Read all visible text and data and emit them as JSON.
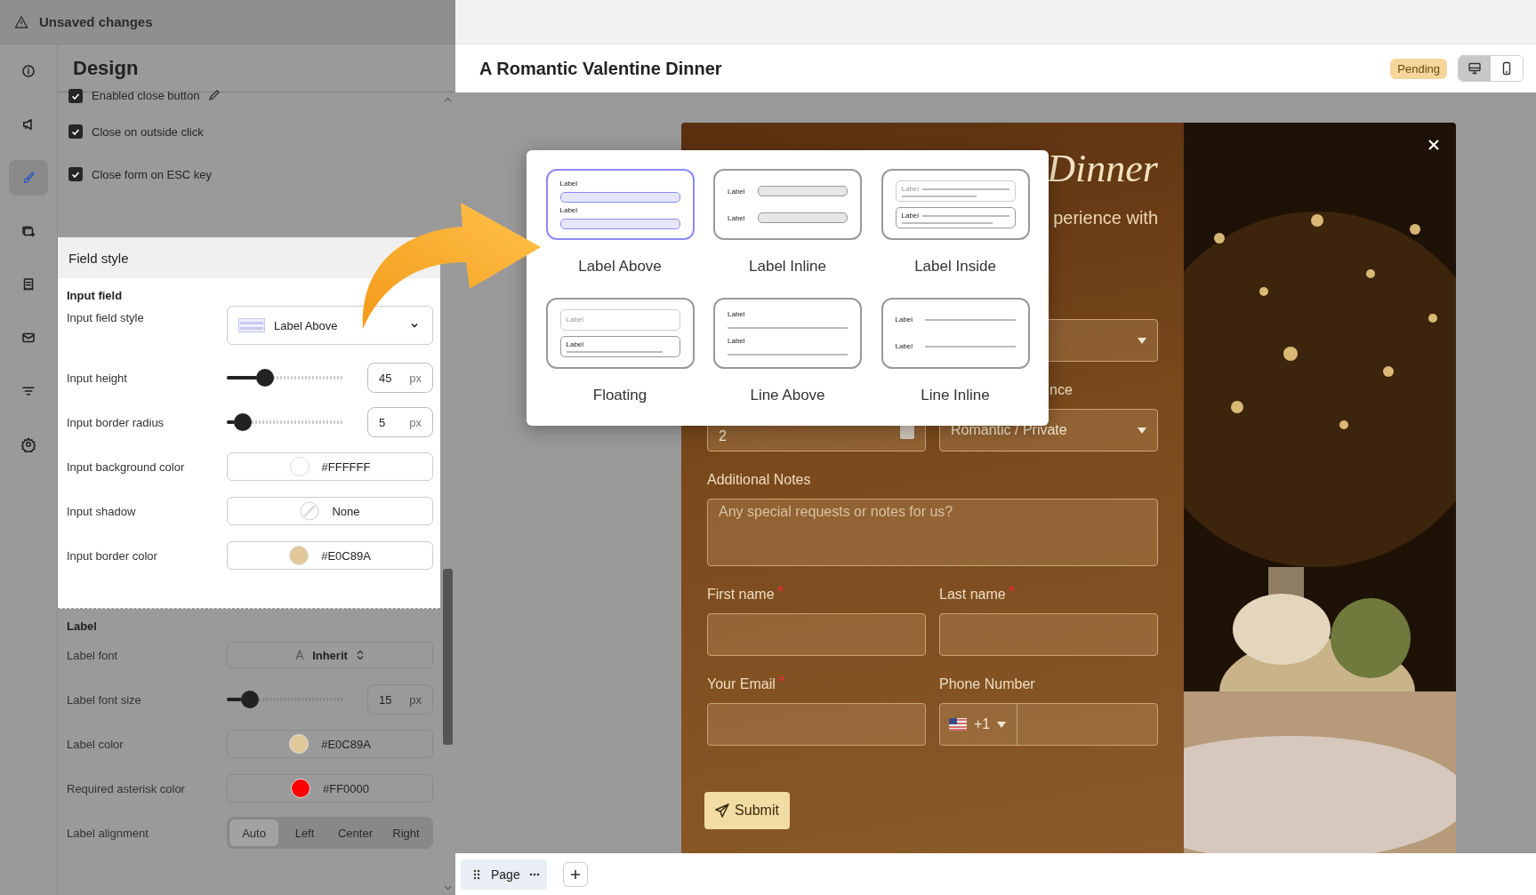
{
  "top_bar": {
    "title": "Unsaved changes"
  },
  "rail": [
    {
      "kind": "info",
      "selected": false
    },
    {
      "kind": "megaphone",
      "selected": false
    },
    {
      "kind": "brush",
      "selected": true
    },
    {
      "kind": "stack",
      "selected": false
    },
    {
      "kind": "receipt",
      "selected": false
    },
    {
      "kind": "mail",
      "selected": false
    },
    {
      "kind": "filter",
      "selected": false
    },
    {
      "kind": "gear",
      "selected": false
    }
  ],
  "panel": {
    "title": "Design",
    "checkboxes": [
      {
        "label": "Enabled close button",
        "checked": true,
        "editable": true
      },
      {
        "label": "Close on outside click",
        "checked": true,
        "editable": false
      },
      {
        "label": "Close form on ESC key",
        "checked": true,
        "editable": false
      }
    ],
    "sections": [
      {
        "title": "Field style",
        "highlighted": true,
        "group": "Input field",
        "rows": [
          {
            "kind": "select",
            "label": "Input field style",
            "value": "Label Above"
          },
          {
            "kind": "slider",
            "label": "Input height",
            "level": 0.33,
            "value": "45",
            "unit": "px"
          },
          {
            "kind": "slider",
            "label": "Input border radius",
            "level": 0.14,
            "value": "5",
            "unit": "px"
          },
          {
            "kind": "color",
            "label": "Input background color",
            "value": "#FFFFFF"
          },
          {
            "kind": "shadow",
            "label": "Input shadow",
            "value": "None"
          },
          {
            "kind": "color",
            "label": "Input border color",
            "value": "#E0C89A"
          }
        ]
      },
      {
        "group": "Label",
        "highlighted": false,
        "rows": [
          {
            "kind": "font",
            "label": "Label font",
            "value": "Inherit"
          },
          {
            "kind": "slider",
            "label": "Label font size",
            "level": 0.2,
            "value": "15",
            "unit": "px"
          },
          {
            "kind": "color",
            "label": "Label color",
            "value": "#E0C89A"
          },
          {
            "kind": "color",
            "label": "Required asterisk color",
            "value": "#FF0000"
          },
          {
            "kind": "segmented",
            "label": "Label alignment",
            "options": [
              {
                "label": "Auto",
                "selected": true
              },
              {
                "label": "Left",
                "selected": false
              },
              {
                "label": "Center",
                "selected": false
              },
              {
                "label": "Right",
                "selected": false
              }
            ]
          }
        ]
      }
    ]
  },
  "header": {
    "title": "A Romantic Valentine Dinner",
    "status": "Pending",
    "devices": [
      {
        "kind": "desktop",
        "selected": true
      },
      {
        "kind": "mobile",
        "selected": false
      }
    ]
  },
  "form": {
    "title": "Dinner",
    "subtitle": "perience with",
    "rows": [
      [
        {
          "kind": "spacer"
        },
        {
          "kind": "select"
        }
      ],
      [
        {
          "kind": "number",
          "value": "2"
        },
        {
          "kind": "select",
          "label": "nce",
          "value": "Romantic / Private"
        }
      ],
      [
        {
          "kind": "textarea",
          "label": "Additional Notes",
          "placeholder": "Any special requests or notes for us?"
        }
      ],
      [
        {
          "kind": "text",
          "label": "First name",
          "required": true
        },
        {
          "kind": "text",
          "label": "Last name",
          "required": true
        }
      ],
      [
        {
          "kind": "text",
          "label": "Your Email",
          "required": true
        },
        {
          "kind": "phone",
          "label": "Phone Number",
          "value": "+1"
        }
      ]
    ],
    "submit": "Submit"
  },
  "popup": {
    "options": [
      {
        "kind": "label-above",
        "label": "Label Above",
        "selected": true,
        "preview_labels": [
          "Label",
          "Label"
        ]
      },
      {
        "kind": "label-inline",
        "label": "Label Inline",
        "selected": false,
        "preview_labels": [
          "Label",
          "Label"
        ]
      },
      {
        "kind": "label-inside",
        "label": "Label Inside",
        "selected": false,
        "preview_labels": [
          "Label",
          "Label"
        ]
      },
      {
        "kind": "floating",
        "label": "Floating",
        "selected": false,
        "preview_labels": [
          "Label",
          "Label"
        ]
      },
      {
        "kind": "line-above",
        "label": "Line Above",
        "selected": false,
        "preview_labels": [
          "Label",
          "Label"
        ]
      },
      {
        "kind": "line-inline",
        "label": "Line Inline",
        "selected": false,
        "preview_labels": [
          "Label",
          "Label"
        ]
      }
    ]
  },
  "bottom_bar": {
    "page": "Page"
  }
}
